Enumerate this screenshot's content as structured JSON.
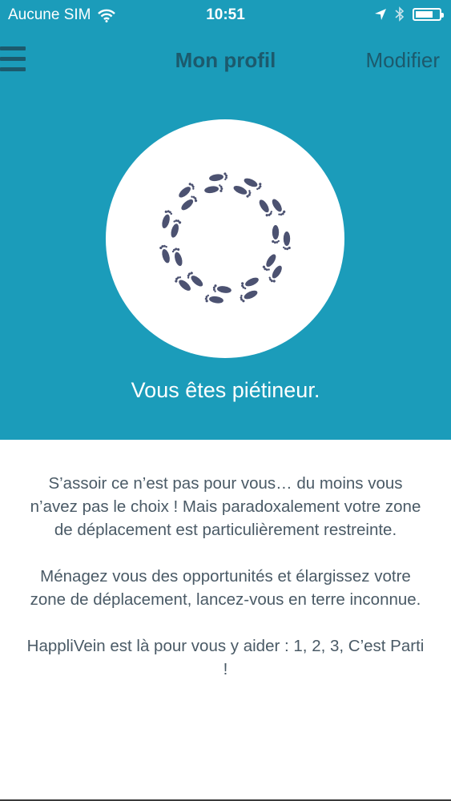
{
  "status_bar": {
    "carrier": "Aucune SIM",
    "time": "10:51",
    "battery_level": 0.75,
    "icons": [
      "wifi-icon",
      "location-arrow-icon",
      "bluetooth-icon",
      "battery-icon"
    ]
  },
  "navbar": {
    "menu_icon": "hamburger-menu-icon",
    "title": "Mon profil",
    "action_label": "Modifier"
  },
  "profile": {
    "badge_icon": "footprints-circle-icon",
    "caption": "Vous êtes piétineur."
  },
  "description": {
    "paragraphs": [
      "S’assoir ce n’est pas pour vous… du moins vous n’avez pas le choix ! Mais paradoxalement votre zone de déplacement est particulièrement restreinte.",
      "Ménagez vous des opportunités et élargissez votre zone de déplacement, lancez-vous en terre inconnue.",
      "HappliVein est là pour vous y aider : 1, 2, 3, C’est Parti !"
    ]
  },
  "colors": {
    "header_bg": "#1b9cba",
    "nav_text": "#1c5a6d",
    "footprint": "#4c5271",
    "body_text": "#4a5a66"
  }
}
